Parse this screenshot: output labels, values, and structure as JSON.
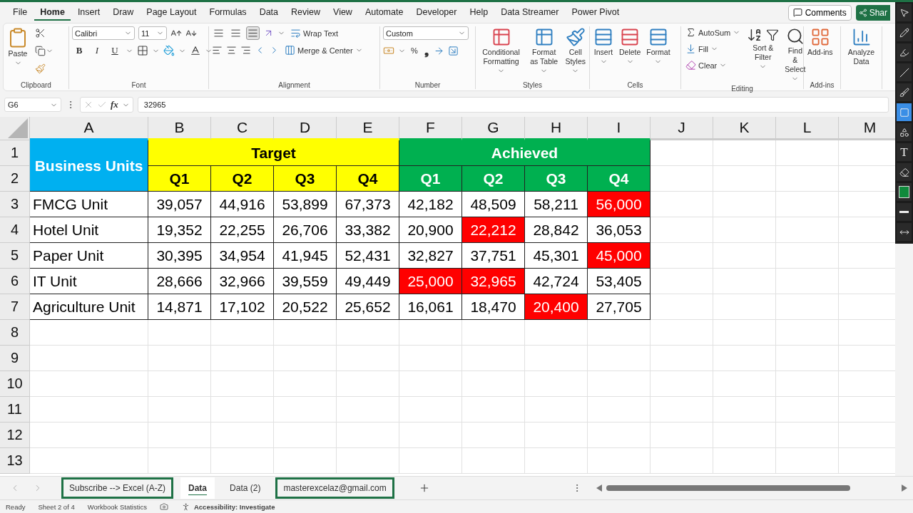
{
  "menu_tabs": [
    {
      "label": "File",
      "selected": false
    },
    {
      "label": "Home",
      "selected": true
    },
    {
      "label": "Insert",
      "selected": false
    },
    {
      "label": "Draw",
      "selected": false
    },
    {
      "label": "Page Layout",
      "selected": false
    },
    {
      "label": "Formulas",
      "selected": false
    },
    {
      "label": "Data",
      "selected": false
    },
    {
      "label": "Review",
      "selected": false
    },
    {
      "label": "View",
      "selected": false
    },
    {
      "label": "Automate",
      "selected": false
    },
    {
      "label": "Developer",
      "selected": false
    },
    {
      "label": "Help",
      "selected": false
    },
    {
      "label": "Data Streamer",
      "selected": false
    },
    {
      "label": "Power Pivot",
      "selected": false
    }
  ],
  "header_buttons": {
    "comments": "Comments",
    "share": "Shar"
  },
  "ribbon": {
    "clipboard": {
      "label": "Clipboard",
      "paste": "Paste"
    },
    "font": {
      "label": "Font",
      "font_name": "Calibri",
      "font_size": "11",
      "bold": "B",
      "italic": "I",
      "underline": "U"
    },
    "alignment": {
      "label": "Alignment",
      "wrap_text": "Wrap Text",
      "merge_center": "Merge & Center",
      "vertical_align": [
        {
          "selected": false
        },
        {
          "selected": false
        },
        {
          "selected": true
        }
      ]
    },
    "number": {
      "label": "Number",
      "format": "Custom",
      "percent": "%",
      "comma": "❟"
    },
    "styles": {
      "label": "Styles",
      "buttons": [
        "Conditional Formatting",
        "Format as Table",
        "Cell Styles"
      ]
    },
    "cells": {
      "label": "Cells",
      "buttons": [
        "Insert",
        "Delete",
        "Format"
      ]
    },
    "editing": {
      "label": "Editing",
      "autosum": "AutoSum",
      "fill": "Fill",
      "clear": "Clear",
      "sort_filter": "Sort & Filter",
      "find_select": "Find & Select"
    },
    "addins": {
      "label": "Add-ins",
      "button": "Add-ins"
    },
    "analysis": {
      "button": "Analyze Data"
    }
  },
  "formula_bar": {
    "name_box": "G6",
    "function_label": "fx",
    "value": "32965"
  },
  "sheet": {
    "columns": [
      "A",
      "B",
      "C",
      "D",
      "E",
      "F",
      "G",
      "H",
      "I",
      "J",
      "K",
      "L",
      "M"
    ],
    "rows": [
      "1",
      "2",
      "3",
      "4",
      "5",
      "6",
      "7",
      "8",
      "9",
      "10",
      "11",
      "12",
      "13"
    ],
    "header": {
      "units": "Business Units",
      "target": "Target",
      "achieved": "Achieved",
      "target_quarters": [
        "Q1",
        "Q2",
        "Q3",
        "Q4"
      ],
      "achieved_quarters": [
        "Q1",
        "Q2",
        "Q3",
        "Q4"
      ]
    },
    "data_rows": [
      {
        "unit": "FMCG Unit",
        "cells": [
          {
            "value": "39,057",
            "highlighted": false
          },
          {
            "value": "44,916",
            "highlighted": false
          },
          {
            "value": "53,899",
            "highlighted": false
          },
          {
            "value": "67,373",
            "highlighted": false
          },
          {
            "value": "42,182",
            "highlighted": false
          },
          {
            "value": "48,509",
            "highlighted": false
          },
          {
            "value": "58,211",
            "highlighted": false
          },
          {
            "value": "56,000",
            "highlighted": true
          }
        ]
      },
      {
        "unit": "Hotel Unit",
        "cells": [
          {
            "value": "19,352",
            "highlighted": false
          },
          {
            "value": "22,255",
            "highlighted": false
          },
          {
            "value": "26,706",
            "highlighted": false
          },
          {
            "value": "33,382",
            "highlighted": false
          },
          {
            "value": "20,900",
            "highlighted": false
          },
          {
            "value": "22,212",
            "highlighted": true
          },
          {
            "value": "28,842",
            "highlighted": false
          },
          {
            "value": "36,053",
            "highlighted": false
          }
        ]
      },
      {
        "unit": "Paper Unit",
        "cells": [
          {
            "value": "30,395",
            "highlighted": false
          },
          {
            "value": "34,954",
            "highlighted": false
          },
          {
            "value": "41,945",
            "highlighted": false
          },
          {
            "value": "52,431",
            "highlighted": false
          },
          {
            "value": "32,827",
            "highlighted": false
          },
          {
            "value": "37,751",
            "highlighted": false
          },
          {
            "value": "45,301",
            "highlighted": false
          },
          {
            "value": "45,000",
            "highlighted": true
          }
        ]
      },
      {
        "unit": "IT Unit",
        "cells": [
          {
            "value": "28,666",
            "highlighted": false
          },
          {
            "value": "32,966",
            "highlighted": false
          },
          {
            "value": "39,559",
            "highlighted": false
          },
          {
            "value": "49,449",
            "highlighted": false
          },
          {
            "value": "25,000",
            "highlighted": true
          },
          {
            "value": "32,965",
            "highlighted": true
          },
          {
            "value": "42,724",
            "highlighted": false
          },
          {
            "value": "53,405",
            "highlighted": false
          }
        ]
      },
      {
        "unit": "Agriculture Unit",
        "cells": [
          {
            "value": "14,871",
            "highlighted": false
          },
          {
            "value": "17,102",
            "highlighted": false
          },
          {
            "value": "20,522",
            "highlighted": false
          },
          {
            "value": "25,652",
            "highlighted": false
          },
          {
            "value": "16,061",
            "highlighted": false
          },
          {
            "value": "18,470",
            "highlighted": false
          },
          {
            "value": "20,400",
            "highlighted": true
          },
          {
            "value": "27,705",
            "highlighted": false
          }
        ]
      }
    ]
  },
  "sheet_tabs": [
    {
      "label": "Subscribe --> Excel (A-Z)",
      "selected": false,
      "outlined": true
    },
    {
      "label": "Data",
      "selected": true,
      "outlined": false
    },
    {
      "label": "Data (2)",
      "selected": false,
      "outlined": false
    },
    {
      "label": "masterexcelaz@gmail.com",
      "selected": false,
      "outlined": true
    }
  ],
  "status_bar": {
    "items": [
      "Ready",
      "Sheet 2 of 4",
      "Workbook Statistics"
    ],
    "accessibility": "Accessibility: Investigate"
  },
  "annotation_tools": [
    {
      "kind": "pointer",
      "selected": false
    },
    {
      "kind": "pencil",
      "selected": false
    },
    {
      "kind": "highlighter",
      "selected": false
    },
    {
      "kind": "line",
      "selected": false
    },
    {
      "kind": "brush",
      "selected": false
    },
    {
      "kind": "rectangle",
      "selected": true
    },
    {
      "kind": "shapes",
      "selected": false
    },
    {
      "kind": "text",
      "label": "T",
      "selected": false
    },
    {
      "kind": "eraser",
      "selected": false
    },
    {
      "kind": "color",
      "color": "#0f8a3c",
      "selected": false
    },
    {
      "kind": "width",
      "selected": false
    },
    {
      "kind": "move",
      "selected": false
    }
  ]
}
